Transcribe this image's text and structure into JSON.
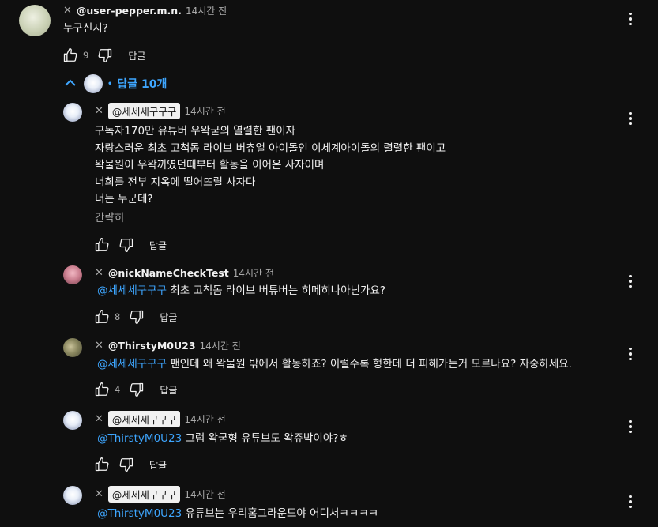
{
  "top_comment": {
    "handle": "@user-pepper.m.n.",
    "time": "14시간 전",
    "text": "누구신지?",
    "likes": "9",
    "reply_label": "답글"
  },
  "replies_toggle": {
    "label": "답글 10개",
    "dot": "•"
  },
  "replies": [
    {
      "handle": "@세세세구구구",
      "time": "14시간 전",
      "lines": [
        "구독자170만 유튜버 우왁굳의 열렬한 팬이자",
        "자랑스러운 최초 고척돔 라이브 버츄얼 아이돌인 이세계아이돌의 렬렬한 팬이고",
        "왁물원이 우왁끼였던때부터 활동을 이어온 사자이며",
        "너희를 전부 지옥에 떨어뜨릴 사자다",
        "너는 누군데?"
      ],
      "read_more": "간략히",
      "likes": "",
      "reply_label": "답글"
    },
    {
      "handle": "@nickNameCheckTest",
      "time": "14시간 전",
      "mention": "@세세세구구구",
      "text": " 최초 고척돔 라이브 버튜버는 히메히나아닌가요?",
      "likes": "8",
      "reply_label": "답글"
    },
    {
      "handle": "@ThirstyM0U23",
      "time": "14시간 전",
      "mention": "@세세세구구구",
      "text": " 팬인데 왜 왁물원 밖에서 활동하죠? 이럴수록 형한데 더 피해가는거 모르나요? 자중하세요.",
      "likes": "4",
      "reply_label": "답글"
    },
    {
      "handle": "@세세세구구구",
      "time": "14시간 전",
      "mention": "@ThirstyM0U23",
      "text": "  그럼 왁굳형 유튜브도 왁쥬박이야?ㅎ",
      "likes": "",
      "reply_label": "답글"
    },
    {
      "handle": "@세세세구구구",
      "time": "14시간 전",
      "mention": "@ThirstyM0U23",
      "text": "  유튜브는 우리홈그라운드야 어디서ㅋㅋㅋㅋ"
    }
  ],
  "icons": {
    "like": "thumbs-up-icon",
    "dislike": "thumbs-down-icon",
    "more": "more-vert-icon",
    "remove": "close-icon",
    "chevron": "chevron-up-icon"
  },
  "colors": {
    "background": "#0f0f0f",
    "link": "#3ea6ff",
    "text": "#f1f1f1",
    "muted": "#aaaaaa"
  }
}
